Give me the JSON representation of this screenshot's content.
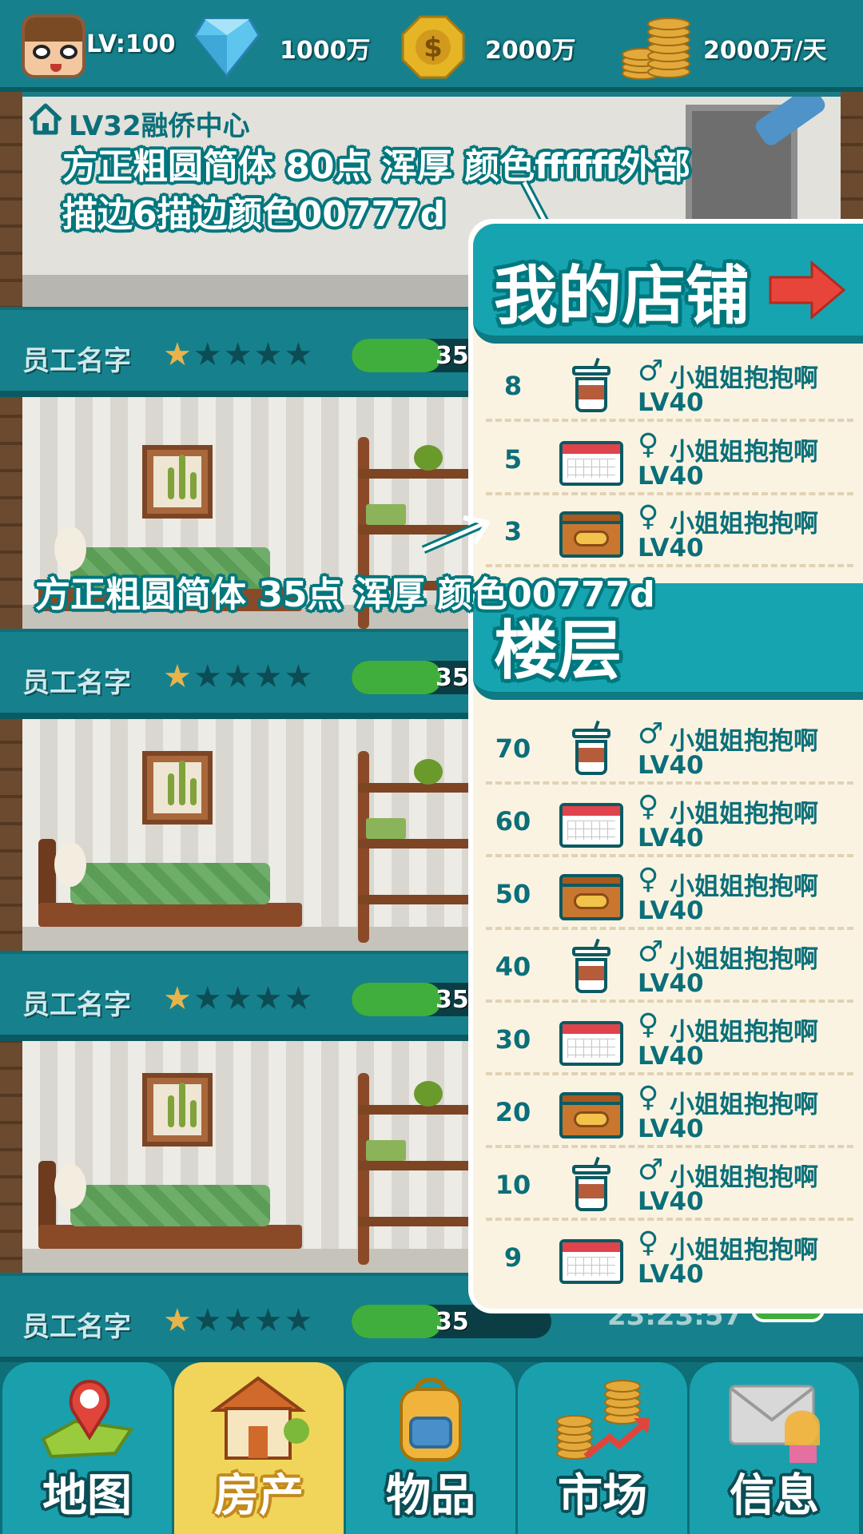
{
  "resources": {
    "level": "LV:100",
    "diamonds": "1000万",
    "coins": "2000万",
    "income": "2000万/天"
  },
  "building": {
    "name": "LV32融侨中心"
  },
  "staff_rows": [
    {
      "name": "员工名字",
      "stars": 1,
      "max_stars": 5,
      "xp_label": "35",
      "xp_fraction": 0.45
    },
    {
      "name": "员工名字",
      "stars": 1,
      "max_stars": 5,
      "xp_label": "35",
      "xp_fraction": 0.45
    },
    {
      "name": "员工名字",
      "stars": 1,
      "max_stars": 5,
      "xp_label": "35",
      "xp_fraction": 0.45
    },
    {
      "name": "员工名字",
      "stars": 1,
      "max_stars": 5,
      "xp_label": "35",
      "xp_fraction": 0.45
    }
  ],
  "partial_timer": "23:23:57",
  "annotations": {
    "title_spec_line1": "方正粗圆简体 80点    浑厚    颜色ffffff外部",
    "title_spec_line2": "描边6描边颜色00777d",
    "row_spec": "方正粗圆简体 35点    浑厚    颜色00777d"
  },
  "panel": {
    "my_shop_title": "我的店铺",
    "floors_title": "楼层",
    "arrow_icon": "red-arrow-right-icon",
    "shop_rows": [
      {
        "num": "8",
        "icon": "coffee-cup-icon",
        "gender": "♂",
        "name": "小姐姐抱抱啊",
        "level": "LV40"
      },
      {
        "num": "5",
        "icon": "calendar-icon",
        "gender": "♀",
        "name": "小姐姐抱抱啊",
        "level": "LV40"
      },
      {
        "num": "3",
        "icon": "box-icon",
        "gender": "♀",
        "name": "小姐姐抱抱啊",
        "level": "LV40"
      }
    ],
    "floor_rows": [
      {
        "num": "70",
        "icon": "coffee-cup-icon",
        "gender": "♂",
        "name": "小姐姐抱抱啊",
        "level": "LV40"
      },
      {
        "num": "60",
        "icon": "calendar-icon",
        "gender": "♀",
        "name": "小姐姐抱抱啊",
        "level": "LV40"
      },
      {
        "num": "50",
        "icon": "box-icon",
        "gender": "♀",
        "name": "小姐姐抱抱啊",
        "level": "LV40"
      },
      {
        "num": "40",
        "icon": "coffee-cup-icon",
        "gender": "♂",
        "name": "小姐姐抱抱啊",
        "level": "LV40"
      },
      {
        "num": "30",
        "icon": "calendar-icon",
        "gender": "♀",
        "name": "小姐姐抱抱啊",
        "level": "LV40"
      },
      {
        "num": "20",
        "icon": "box-icon",
        "gender": "♀",
        "name": "小姐姐抱抱啊",
        "level": "LV40"
      },
      {
        "num": "10",
        "icon": "coffee-cup-icon",
        "gender": "♂",
        "name": "小姐姐抱抱啊",
        "level": "LV40"
      },
      {
        "num": "9",
        "icon": "calendar-icon",
        "gender": "♀",
        "name": "小姐姐抱抱啊",
        "level": "LV40"
      }
    ]
  },
  "bottom_nav": {
    "active": "房产",
    "tabs": [
      {
        "label": "地图",
        "icon": "map-pin-icon"
      },
      {
        "label": "房产",
        "icon": "house-icon"
      },
      {
        "label": "物品",
        "icon": "backpack-icon"
      },
      {
        "label": "市场",
        "icon": "market-coins-icon"
      },
      {
        "label": "信息",
        "icon": "mail-icon"
      }
    ]
  },
  "colors": {
    "accent": "#16a4b1",
    "dark_teal": "#00777d",
    "panel_bg": "#fbf3e2",
    "xp_green": "#3fae3c"
  }
}
